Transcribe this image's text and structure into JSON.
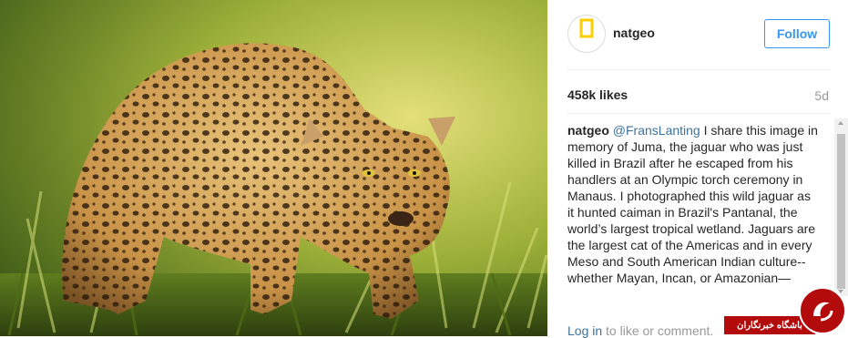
{
  "post": {
    "photo_alt": "jaguar",
    "account": {
      "username": "natgeo",
      "avatar_label": "NATIONAL GEOGRAPHIC",
      "follow_label": "Follow"
    },
    "likes": "458k likes",
    "age": "5d",
    "caption": {
      "username": "natgeo",
      "mention": "@FransLanting",
      "text": " I share this image in memory of Juma, the jaguar who was just killed in Brazil after he escaped from his handlers at an Olympic torch ceremony in Manaus. I photographed this wild jaguar as it hunted caiman in Brazil's Pantanal, the world’s largest tropical wetland. Jaguars are the largest cat of the Americas and in every Meso and South American Indian culture--whether Mayan, Incan, or Amazonian—"
    },
    "login_prompt": {
      "link": "Log in",
      "text": " to like or comment."
    }
  },
  "watermark": {
    "text": "باشگاه خبرنگاران"
  },
  "colors": {
    "accent": "#3897f0",
    "mention": "#3f729b",
    "watermark_red": "#b30b0b"
  }
}
